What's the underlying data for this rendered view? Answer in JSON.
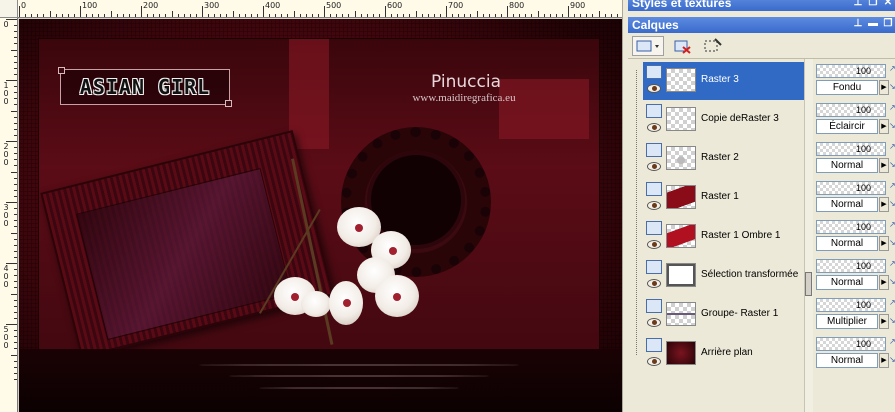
{
  "ruler": {
    "h_labels": [
      "0",
      "100",
      "200",
      "300",
      "400",
      "500",
      "600",
      "700",
      "800",
      "900"
    ],
    "v_labels": [
      "0",
      "1\n0\n0",
      "2\n0\n0",
      "3\n0\n0",
      "4\n0\n0",
      "5\n0\n0"
    ]
  },
  "canvas": {
    "logo_text": "ASIAN GIRL",
    "signature": "Pinuccia",
    "website": "www.maidiregrafica.eu"
  },
  "panels": {
    "styles_title": "Styles et textures",
    "layers_title": "Calques"
  },
  "layers": [
    {
      "name": "Raster 3",
      "opacity": "100",
      "blend": "Fondu",
      "selected": true
    },
    {
      "name": "Copie deRaster 3",
      "opacity": "100",
      "blend": "Éclaircir"
    },
    {
      "name": "Raster 2",
      "opacity": "100",
      "blend": "Normal"
    },
    {
      "name": "Raster 1",
      "opacity": "100",
      "blend": "Normal"
    },
    {
      "name": "Raster 1 Ombre 1",
      "opacity": "100",
      "blend": "Normal"
    },
    {
      "name": "Sélection transformée",
      "opacity": "100",
      "blend": "Normal"
    },
    {
      "name": "Groupe- Raster 1",
      "opacity": "100",
      "blend": "Multiplier"
    },
    {
      "name": "Arrière plan",
      "opacity": "100",
      "blend": "Normal"
    }
  ],
  "colors": {
    "selection": "#316ac5",
    "panel_title": "#3a6bcc",
    "canvas_red": "#7a1420"
  },
  "icons": {
    "toolbar": [
      "new-layer-icon",
      "delete-layer-icon",
      "edit-selection-icon"
    ],
    "title_buttons": [
      "pin-icon",
      "minimize-icon",
      "restore-icon",
      "close-icon"
    ]
  }
}
